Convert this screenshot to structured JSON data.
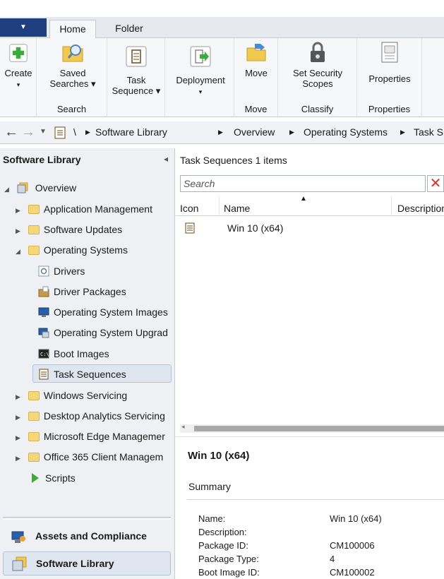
{
  "tabs": {
    "home": "Home",
    "folder": "Folder"
  },
  "ribbon": {
    "create": "Create",
    "saved_searches": [
      "Saved",
      "Searches ▾"
    ],
    "search_group": "Search",
    "task_sequence": [
      "Task",
      "Sequence ▾"
    ],
    "deployment": "Deployment",
    "deployment_arrow": "▾",
    "move": "Move",
    "move_group": "Move",
    "set_security": [
      "Set Security",
      "Scopes"
    ],
    "classify_group": "Classify",
    "properties": "Properties",
    "properties_group": "Properties"
  },
  "address": {
    "sep": "\\",
    "crumbs": [
      "Software Library",
      "Overview",
      "Operating Systems",
      "Task S"
    ]
  },
  "nav": {
    "title": "Software Library",
    "overview": "Overview",
    "items": [
      "Application Management",
      "Software Updates",
      "Operating Systems",
      "Drivers",
      "Driver Packages",
      "Operating System Images",
      "Operating System Upgrad",
      "Boot Images",
      "Task Sequences",
      "Windows Servicing",
      "Desktop Analytics Servicing",
      "Microsoft Edge Managemer",
      "Office 365 Client Managem",
      "Scripts"
    ],
    "workspaces": [
      "Assets and Compliance",
      "Software Library"
    ]
  },
  "list": {
    "title": "Task Sequences 1 items",
    "search_placeholder": "Search",
    "columns": [
      "Icon",
      "Name",
      "Description"
    ],
    "rows": [
      {
        "name": "Win 10 (x64)"
      }
    ]
  },
  "detail": {
    "title": "Win 10 (x64)",
    "section": "Summary",
    "fields": [
      {
        "label": "Name:",
        "value": "Win 10 (x64)"
      },
      {
        "label": "Description:",
        "value": ""
      },
      {
        "label": "Package ID:",
        "value": "CM100006"
      },
      {
        "label": "Package Type:",
        "value": "4"
      },
      {
        "label": "Boot Image ID:",
        "value": "CM100002"
      }
    ]
  }
}
